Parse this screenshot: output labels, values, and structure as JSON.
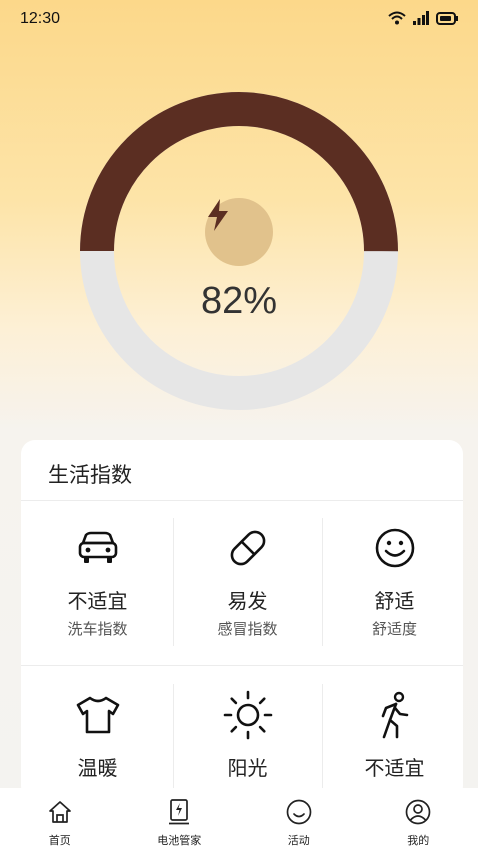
{
  "status_bar": {
    "time": "12:30"
  },
  "battery": {
    "level_percent": 82,
    "level_text": "82%",
    "ring_color": "#5b2e22",
    "track_color": "#e6e6e6"
  },
  "life_index": {
    "title": "生活指数",
    "items": [
      {
        "icon": "car-icon",
        "value": "不适宜",
        "label": "洗车指数"
      },
      {
        "icon": "pill-icon",
        "value": "易发",
        "label": "感冒指数"
      },
      {
        "icon": "smiley-icon",
        "value": "舒适",
        "label": "舒适度"
      },
      {
        "icon": "tshirt-icon",
        "value": "温暖",
        "label": ""
      },
      {
        "icon": "sun-icon",
        "value": "阳光",
        "label": ""
      },
      {
        "icon": "walking-icon",
        "value": "不适宜",
        "label": ""
      }
    ]
  },
  "tabbar": {
    "items": [
      {
        "icon": "home-icon",
        "label": "首页"
      },
      {
        "icon": "battery-manager-icon",
        "label": "电池管家"
      },
      {
        "icon": "activity-smile-icon",
        "label": "活动"
      },
      {
        "icon": "profile-icon",
        "label": "我的"
      }
    ]
  }
}
